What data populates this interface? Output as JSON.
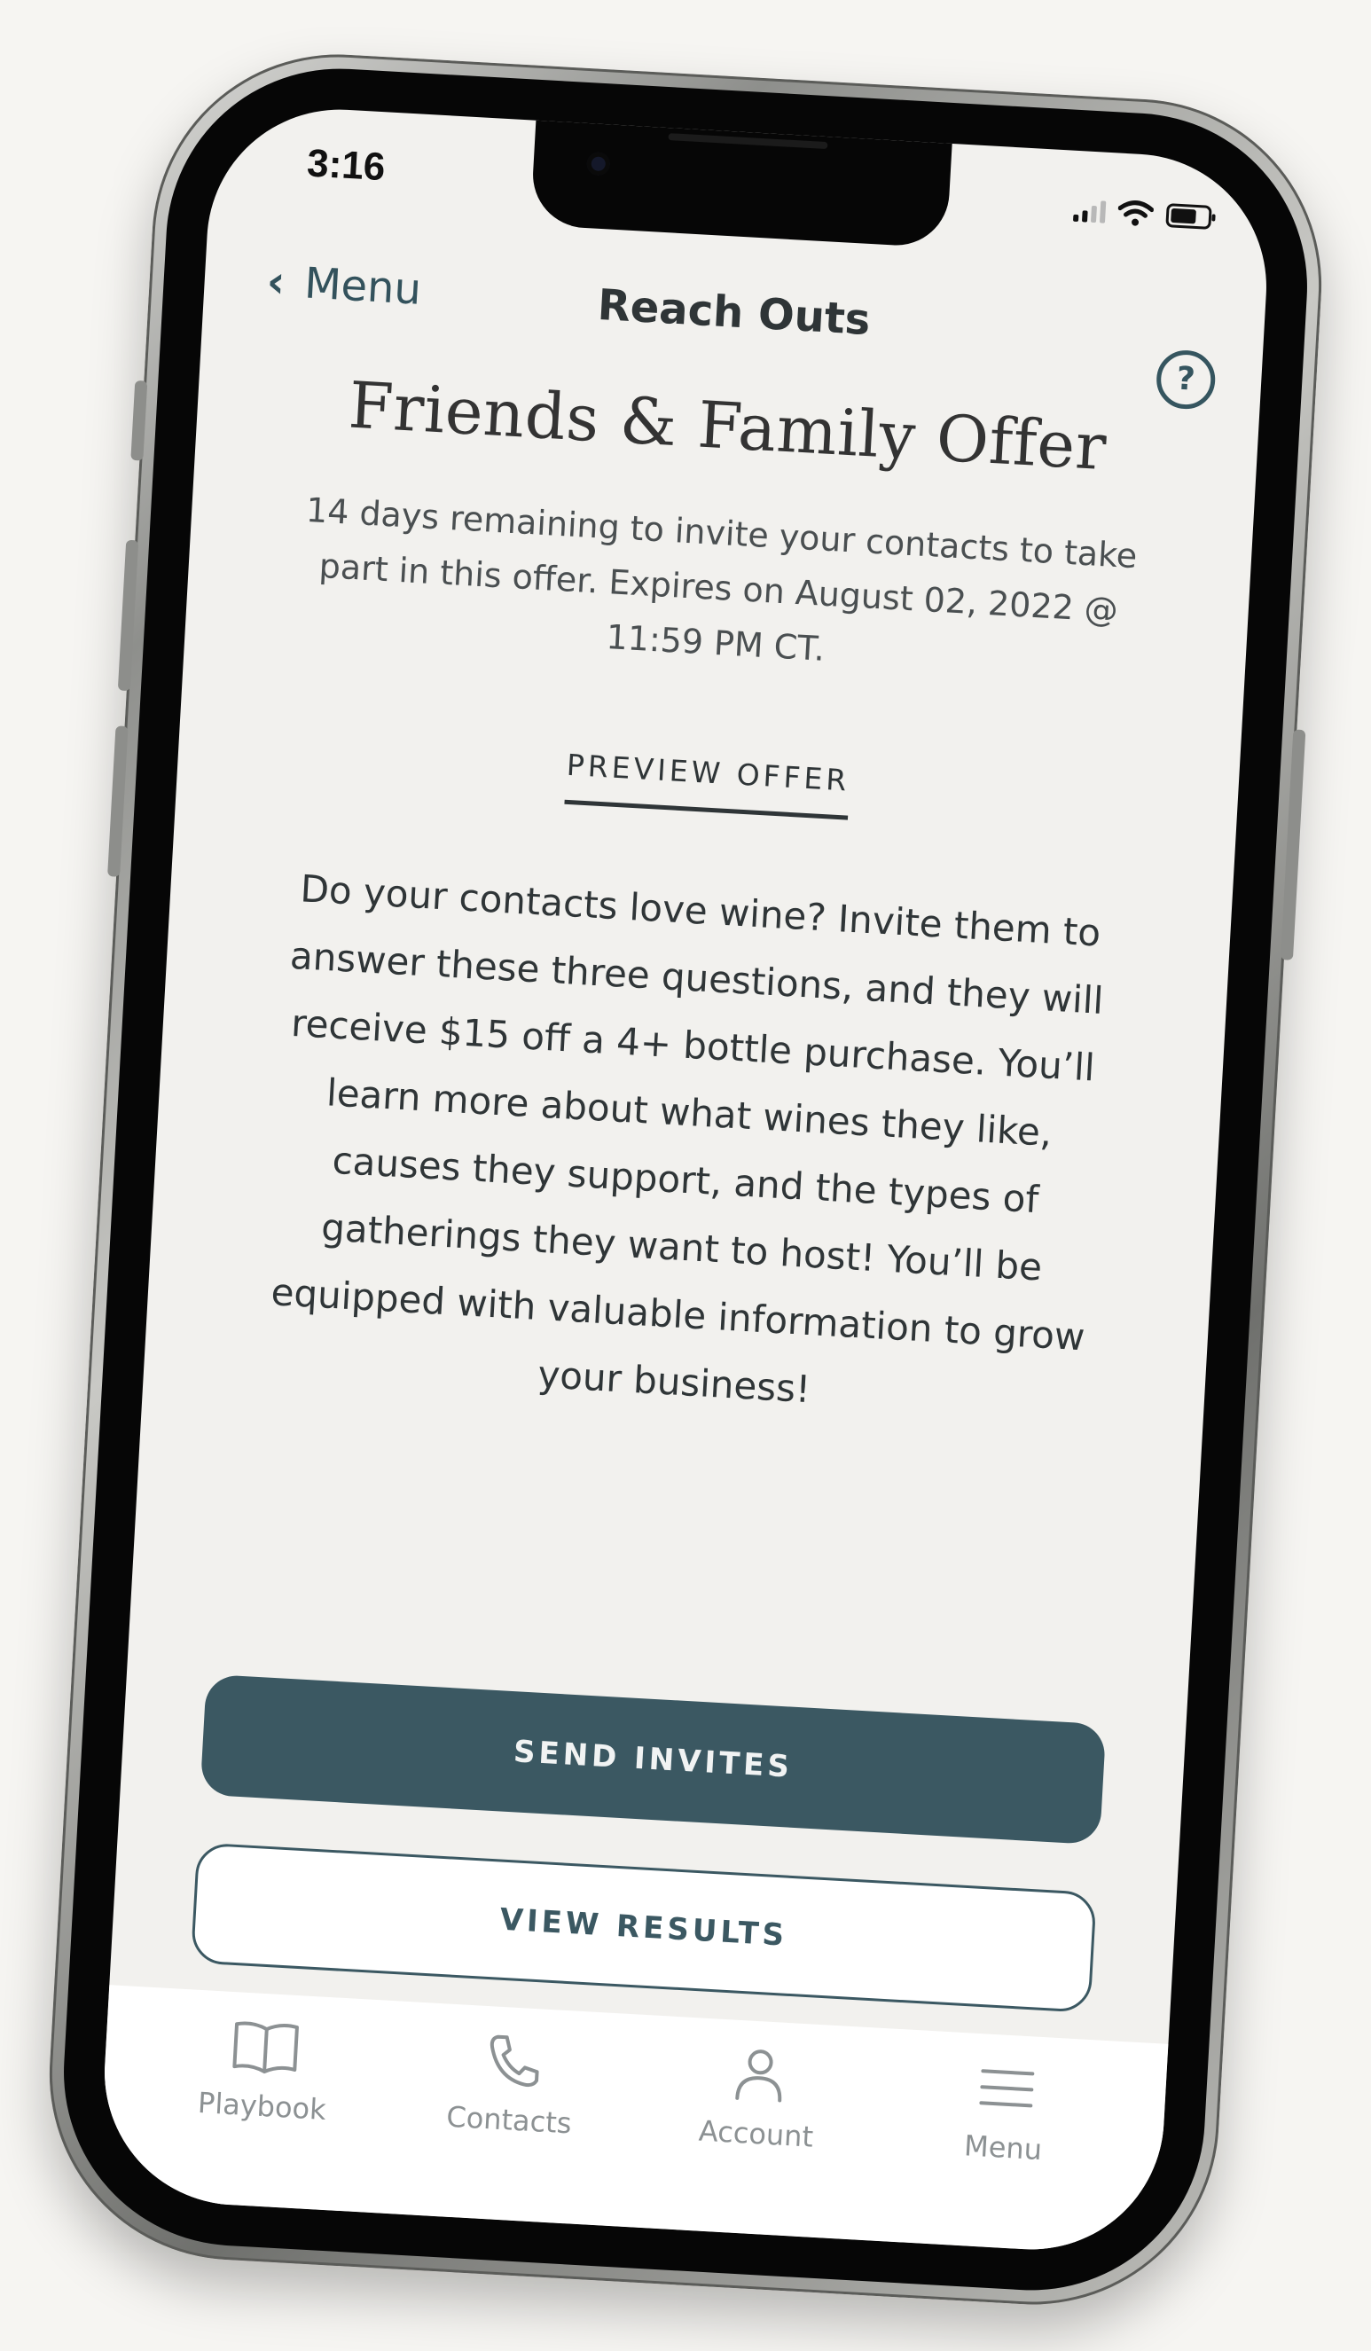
{
  "status_bar": {
    "time": "3:16"
  },
  "nav": {
    "back_label": "Menu",
    "title": "Reach Outs",
    "help_glyph": "?"
  },
  "offer": {
    "title": "Friends & Family Offer",
    "expiry_text": "14 days remaining to invite your contacts to take part in this offer. Expires on August 02, 2022 @ 11:59 PM CT.",
    "preview_link": "PREVIEW OFFER",
    "description": "Do your contacts love wine? Invite them to answer these three questions, and they will receive $15 off a 4+ bottle purchase. You’ll learn more about what wines they like, causes they support, and the types of gatherings they want to host! You’ll be equipped with valuable information to grow your business!"
  },
  "actions": {
    "send_invites": "SEND INVITES",
    "view_results": "VIEW RESULTS"
  },
  "tab_bar": {
    "items": [
      {
        "label": "Playbook",
        "icon": "book-icon"
      },
      {
        "label": "Contacts",
        "icon": "phone-icon"
      },
      {
        "label": "Account",
        "icon": "person-icon"
      },
      {
        "label": "Menu",
        "icon": "hamburger-icon"
      }
    ]
  },
  "colors": {
    "primary": "#3b5862",
    "background": "#f2f1ee",
    "text": "#2f3537",
    "tab_inactive": "#8c9193"
  }
}
